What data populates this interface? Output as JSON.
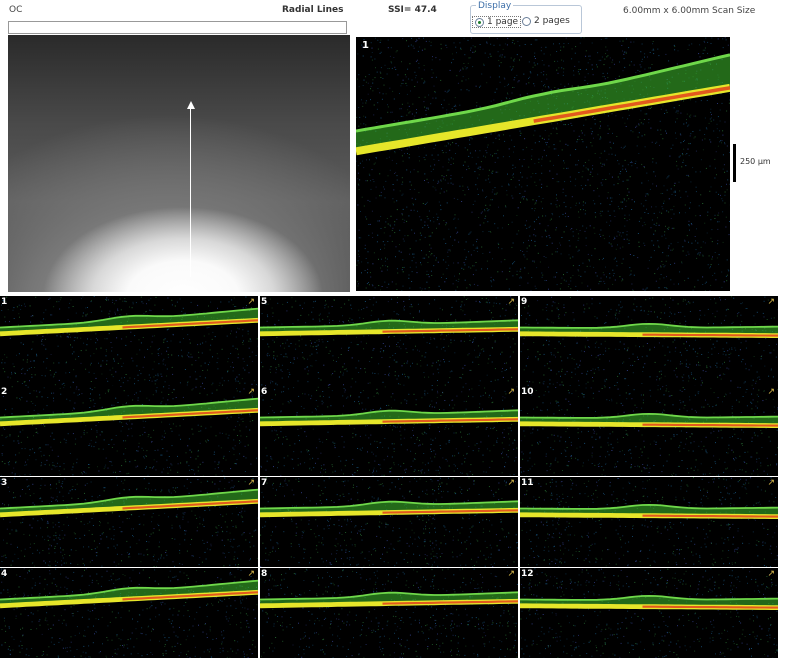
{
  "header": {
    "eye": "OC",
    "scan_type": "Radial Lines",
    "ssi": "SSI= 47.4",
    "display_label": "Display",
    "options": [
      "1 page",
      "2 pages"
    ],
    "selected_option": "1 page",
    "scan_size": "6.00mm x 6.00mm Scan Size"
  },
  "main_scan": {
    "number": "1",
    "scale_label": "250 µm"
  },
  "thumbnails": [
    {
      "number": "1"
    },
    {
      "number": "2"
    },
    {
      "number": "3"
    },
    {
      "number": "4"
    },
    {
      "number": "5"
    },
    {
      "number": "6"
    },
    {
      "number": "7"
    },
    {
      "number": "8"
    },
    {
      "number": "9"
    },
    {
      "number": "10"
    },
    {
      "number": "11"
    },
    {
      "number": "12"
    }
  ],
  "colors": {
    "retina_green": "#3fbf2e",
    "retina_yellow": "#e6e62a",
    "rpe_red": "#e0401c",
    "background": "#000000"
  }
}
